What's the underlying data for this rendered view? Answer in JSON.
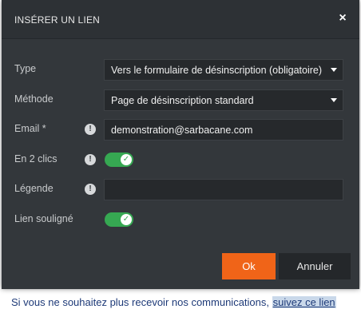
{
  "dialog": {
    "title": "INSÉRER UN LIEN",
    "close_glyph": "×",
    "close_icon": "close-icon"
  },
  "fields": {
    "type": {
      "label": "Type",
      "value": "Vers le formulaire de désinscription (obligatoire)"
    },
    "method": {
      "label": "Méthode",
      "value": "Page de désinscription standard"
    },
    "email": {
      "label": "Email *",
      "value": "demonstration@sarbacane.com",
      "info_icon": "info-icon"
    },
    "two_clicks": {
      "label": "En 2 clics",
      "enabled": true,
      "info_icon": "info-icon"
    },
    "legend": {
      "label": "Légende",
      "value": "",
      "info_icon": "info-icon"
    },
    "underline": {
      "label": "Lien souligné",
      "enabled": true
    }
  },
  "info_glyph": "!",
  "check_glyph": "✓",
  "buttons": {
    "ok": "Ok",
    "cancel": "Annuler"
  },
  "footer": {
    "text": "Si vous ne souhaitez plus recevoir nos communications,",
    "link": "suivez ce lien"
  },
  "colors": {
    "dialog_bg": "#33373b",
    "accent_orange": "#f06418",
    "toggle_green": "#36a852",
    "link_blue": "#1e3a78"
  }
}
